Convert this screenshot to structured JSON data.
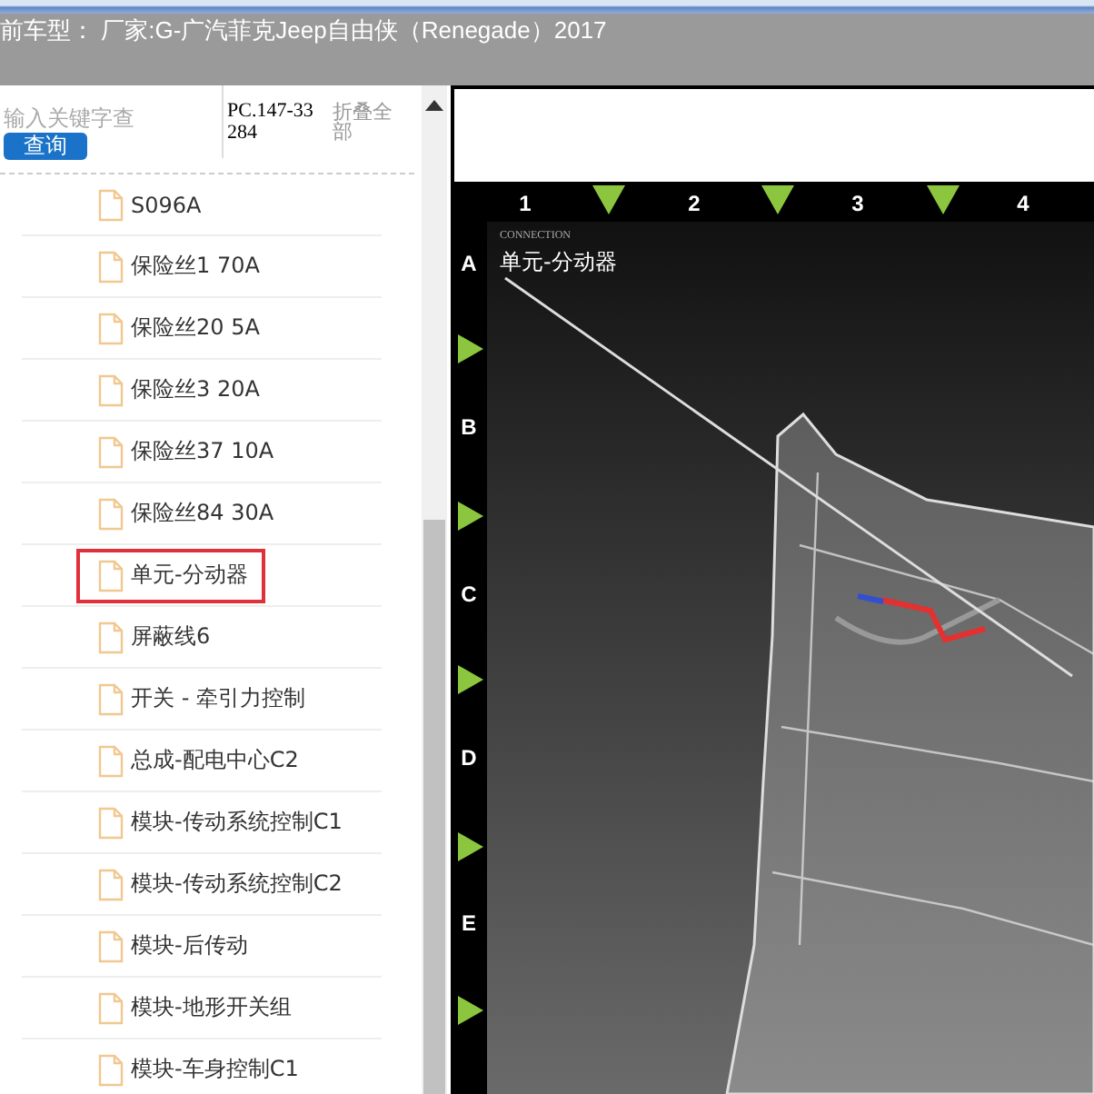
{
  "title": "前车型： 厂家:G-广汽菲克Jeep自由侠（Renegade）2017",
  "search": {
    "placeholder": "输入关键字查",
    "button": "查询"
  },
  "part_number": "PC.147-33284",
  "collapse_all": "折叠全部",
  "tree_items": [
    {
      "label": "S096A",
      "selected": false
    },
    {
      "label": "保险丝1 70A",
      "selected": false
    },
    {
      "label": "保险丝20 5A",
      "selected": false
    },
    {
      "label": "保险丝3 20A",
      "selected": false
    },
    {
      "label": "保险丝37 10A",
      "selected": false
    },
    {
      "label": "保险丝84 30A",
      "selected": false
    },
    {
      "label": "单元-分动器",
      "selected": true
    },
    {
      "label": "屏蔽线6",
      "selected": false
    },
    {
      "label": "开关 - 牵引力控制",
      "selected": false
    },
    {
      "label": "总成-配电中心C2",
      "selected": false
    },
    {
      "label": "模块-传动系统控制C1",
      "selected": false
    },
    {
      "label": "模块-传动系统控制C2",
      "selected": false
    },
    {
      "label": "模块-后传动",
      "selected": false
    },
    {
      "label": "模块-地形开关组",
      "selected": false
    },
    {
      "label": "模块-车身控制C1",
      "selected": false
    }
  ],
  "diagram": {
    "columns": [
      "1",
      "2",
      "3",
      "4"
    ],
    "rows": [
      "A",
      "B",
      "C",
      "D",
      "E"
    ],
    "caption": "CONNECTION",
    "callout": "单元-分动器"
  }
}
